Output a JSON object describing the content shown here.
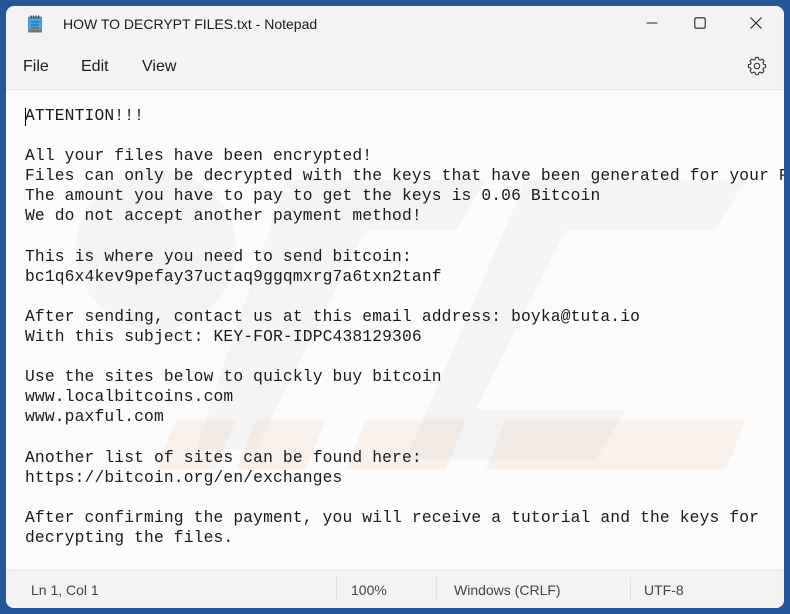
{
  "window": {
    "title": "HOW TO DECRYPT FILES.txt - Notepad",
    "app_icon": "notepad-icon",
    "controls": {
      "minimize": "minimize-icon",
      "maximize": "maximize-icon",
      "close": "close-icon"
    }
  },
  "menu": {
    "items": [
      {
        "label": "File"
      },
      {
        "label": "Edit"
      },
      {
        "label": "View"
      }
    ],
    "settings_icon": "gear-icon"
  },
  "editor": {
    "lines": [
      "ATTENTION!!!",
      "",
      "All your files have been encrypted!",
      "Files can only be decrypted with the keys that have been generated for your PC!",
      "The amount you have to pay to get the keys is 0.06 Bitcoin",
      "We do not accept another payment method!",
      "",
      "This is where you need to send bitcoin:",
      "bc1q6x4kev9pefay37uctaq9ggqmxrg7a6txn2tanf",
      "",
      "After sending, contact us at this email address: boyka@tuta.io",
      "With this subject: KEY-FOR-IDPC438129306",
      "",
      "Use the sites below to quickly buy bitcoin",
      "www.localbitcoins.com",
      "www.paxful.com",
      "",
      "Another list of sites can be found here:",
      "https://bitcoin.org/en/exchanges",
      "",
      "After confirming the payment, you will receive a tutorial and the keys for",
      "decrypting the files."
    ]
  },
  "status": {
    "position": "Ln 1, Col 1",
    "zoom": "100%",
    "line_ending": "Windows (CRLF)",
    "encoding": "UTF-8"
  },
  "colors": {
    "desktop": "#24579a",
    "chrome": "#f3f3f3",
    "editor_bg": "#fbfbfb"
  }
}
